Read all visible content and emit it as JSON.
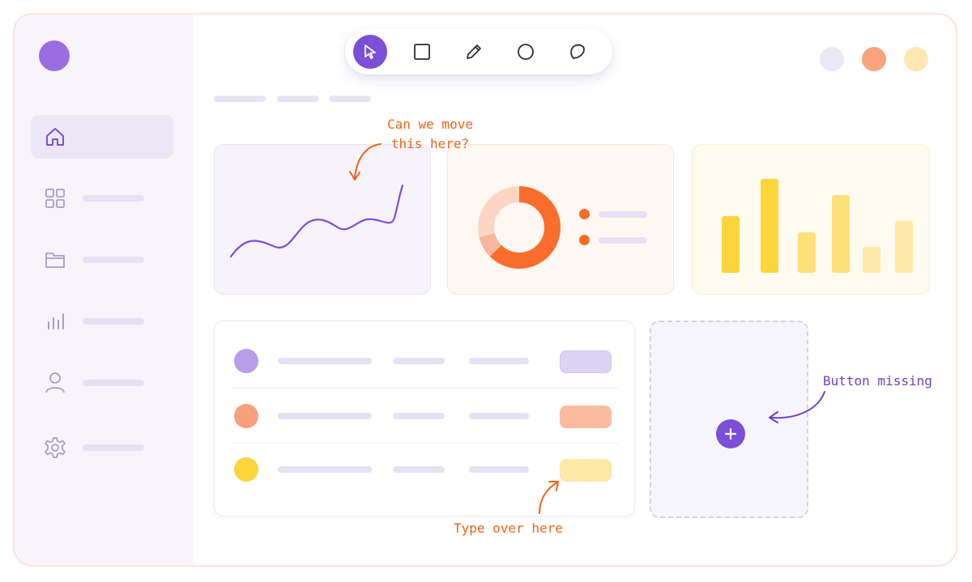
{
  "sidebar": {
    "items": [
      {
        "icon": "home-icon",
        "active": true
      },
      {
        "icon": "grid-icon",
        "active": false
      },
      {
        "icon": "folder-icon",
        "active": false
      },
      {
        "icon": "bar-chart-icon",
        "active": false
      },
      {
        "icon": "user-icon",
        "active": false
      },
      {
        "icon": "gear-icon",
        "active": false
      }
    ]
  },
  "toolbar": {
    "tools": [
      "cursor-icon",
      "square-icon",
      "pencil-icon",
      "circle-icon",
      "lasso-icon"
    ],
    "active_tool": "cursor-icon"
  },
  "header": {
    "color_dots": [
      "#ece9f6",
      "#f8a47c",
      "#fde8b2"
    ]
  },
  "charts": {
    "line": {
      "color": "#7c4fd8"
    },
    "donut": {
      "colors": [
        "#fb6d2c",
        "#f6b69b",
        "#fbd6c4"
      ]
    },
    "bars": {
      "colors": [
        "#fcd43c",
        "#fde07a",
        "#fee9a8"
      ]
    }
  },
  "table": {
    "rows": [
      {
        "dot_color": "#b79ee6",
        "pill_color": "#ddd3f4"
      },
      {
        "dot_color": "#f8a07c",
        "pill_color": "#fbbba0"
      },
      {
        "dot_color": "#fcd43c",
        "pill_color": "#fde8a6"
      }
    ]
  },
  "add_card": {
    "button_icon": "plus-icon"
  },
  "annotations": {
    "move": "Can we move\nthis here?",
    "missing": "Button missing",
    "type": "Type over here"
  },
  "colors": {
    "accent": "#7c4fd8",
    "annotation_orange": "#f06318",
    "annotation_purple": "#6f41cf"
  }
}
